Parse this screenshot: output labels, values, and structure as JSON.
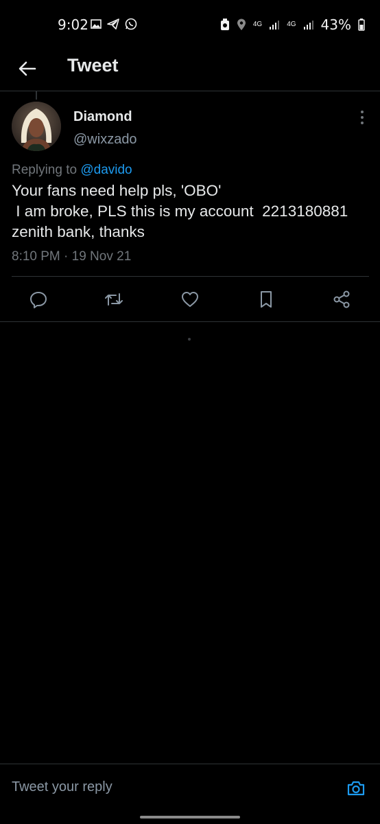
{
  "status_bar": {
    "time": "9:02",
    "battery": "43%",
    "network_labels": [
      "4G",
      "4G"
    ],
    "left_icons": [
      "gallery-icon",
      "telegram-icon",
      "whatsapp-icon"
    ],
    "right_icons": [
      "battery-saver-icon",
      "location-icon",
      "signal-icon",
      "signal-icon",
      "battery-icon"
    ]
  },
  "header": {
    "title": "Tweet",
    "back_icon": "arrow-left-icon"
  },
  "tweet": {
    "author_name": "Diamond",
    "author_handle": "@wixzado",
    "replying_prefix": "Replying to",
    "replying_to": "@davido",
    "text": "Your fans need help pls, 'OBO'\n I am broke, PLS this is my account  2213180881\nzenith bank, thanks",
    "timestamp": "8:10 PM · 19 Nov 21"
  },
  "actions": [
    {
      "name": "reply",
      "icon": "comment-icon"
    },
    {
      "name": "retweet",
      "icon": "retweet-icon"
    },
    {
      "name": "like",
      "icon": "heart-icon"
    },
    {
      "name": "bookmark",
      "icon": "bookmark-icon"
    },
    {
      "name": "share",
      "icon": "share-icon"
    }
  ],
  "reply_bar": {
    "placeholder": "Tweet your reply",
    "camera_icon": "camera-icon"
  },
  "colors": {
    "background": "#000000",
    "text": "#e7e9ea",
    "secondary_text": "#71767b",
    "accent": "#1d9bf0",
    "divider": "#2f3336"
  }
}
